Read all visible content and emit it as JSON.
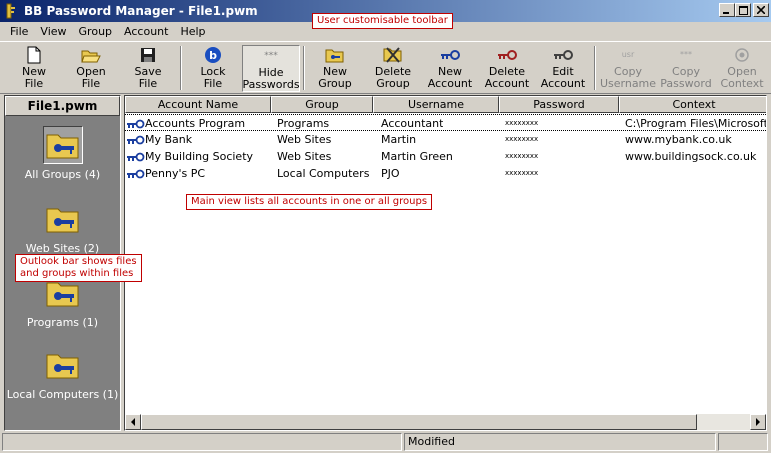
{
  "window": {
    "title": "BB Password Manager - File1.pwm"
  },
  "menu": [
    "File",
    "View",
    "Group",
    "Account",
    "Help"
  ],
  "toolbar": {
    "buttons": [
      {
        "line1": "New",
        "line2": "File",
        "icon": "new-file-icon"
      },
      {
        "line1": "Open",
        "line2": "File",
        "icon": "open-file-icon"
      },
      {
        "line1": "Save",
        "line2": "File",
        "icon": "save-file-icon"
      },
      {
        "line1": "Lock",
        "line2": "File",
        "icon": "lock-file-icon"
      },
      {
        "line1": "Hide",
        "line2": "Passwords",
        "icon": "hide-passwords-icon",
        "icon_text": "***"
      },
      {
        "line1": "New",
        "line2": "Group",
        "icon": "new-group-icon"
      },
      {
        "line1": "Delete",
        "line2": "Group",
        "icon": "delete-group-icon"
      },
      {
        "line1": "New",
        "line2": "Account",
        "icon": "new-account-icon"
      },
      {
        "line1": "Delete",
        "line2": "Account",
        "icon": "delete-account-icon"
      },
      {
        "line1": "Edit",
        "line2": "Account",
        "icon": "edit-account-icon"
      },
      {
        "line1": "Copy",
        "line2": "Username",
        "icon": "copy-username-icon",
        "icon_text": "usr"
      },
      {
        "line1": "Copy",
        "line2": "Password",
        "icon": "copy-password-icon",
        "icon_text": "***"
      },
      {
        "line1": "Open",
        "line2": "Context",
        "icon": "open-context-icon"
      }
    ]
  },
  "callouts": {
    "toolbar": "User customisable toolbar",
    "main_view": "Main view lists all accounts in one or all groups",
    "outlook_line1": "Outlook bar shows files",
    "outlook_line2": "and groups within files"
  },
  "outlook": {
    "file": "File1.pwm",
    "groups": [
      "All Groups (4)",
      "Web Sites (2)",
      "Programs (1)",
      "Local Computers (1)"
    ]
  },
  "list": {
    "columns": [
      "Account Name",
      "Group",
      "Username",
      "Password",
      "Context"
    ],
    "rows": [
      {
        "name": "Accounts Program",
        "group": "Programs",
        "username": "Accountant",
        "password": "xxxxxxxx",
        "context": "C:\\Program Files\\Microsoft\\M"
      },
      {
        "name": "My Bank",
        "group": "Web Sites",
        "username": "Martin",
        "password": "xxxxxxxx",
        "context": "www.mybank.co.uk"
      },
      {
        "name": "My Building Society",
        "group": "Web Sites",
        "username": "Martin Green",
        "password": "xxxxxxxx",
        "context": "www.buildingsock.co.uk"
      },
      {
        "name": "Penny's PC",
        "group": "Local Computers",
        "username": "PJO",
        "password": "xxxxxxxx",
        "context": ""
      }
    ]
  },
  "status": {
    "text": "Modified"
  }
}
